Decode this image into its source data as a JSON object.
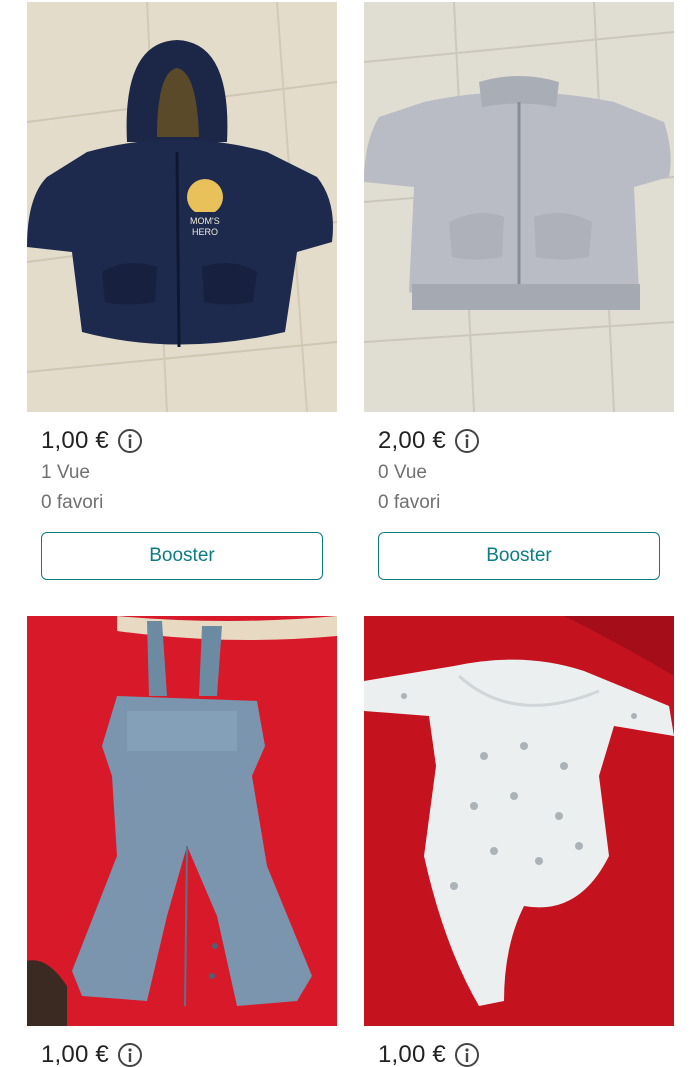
{
  "items": [
    {
      "price": "1,00 €",
      "views": "1 Vue",
      "favorites": "0 favori",
      "boost_label": "Booster",
      "photo": "navy-hoodie-photo"
    },
    {
      "price": "2,00 €",
      "views": "0 Vue",
      "favorites": "0 favori",
      "boost_label": "Booster",
      "photo": "grey-knit-cardigan-photo"
    },
    {
      "price": "1,00 €",
      "photo": "blue-overalls-photo"
    },
    {
      "price": "1,00 €",
      "photo": "white-star-bodysuit-photo"
    }
  ],
  "icons": {
    "info": "info-circle-icon"
  },
  "colors": {
    "accent": "#0c7c83",
    "muted_text": "#707070"
  }
}
